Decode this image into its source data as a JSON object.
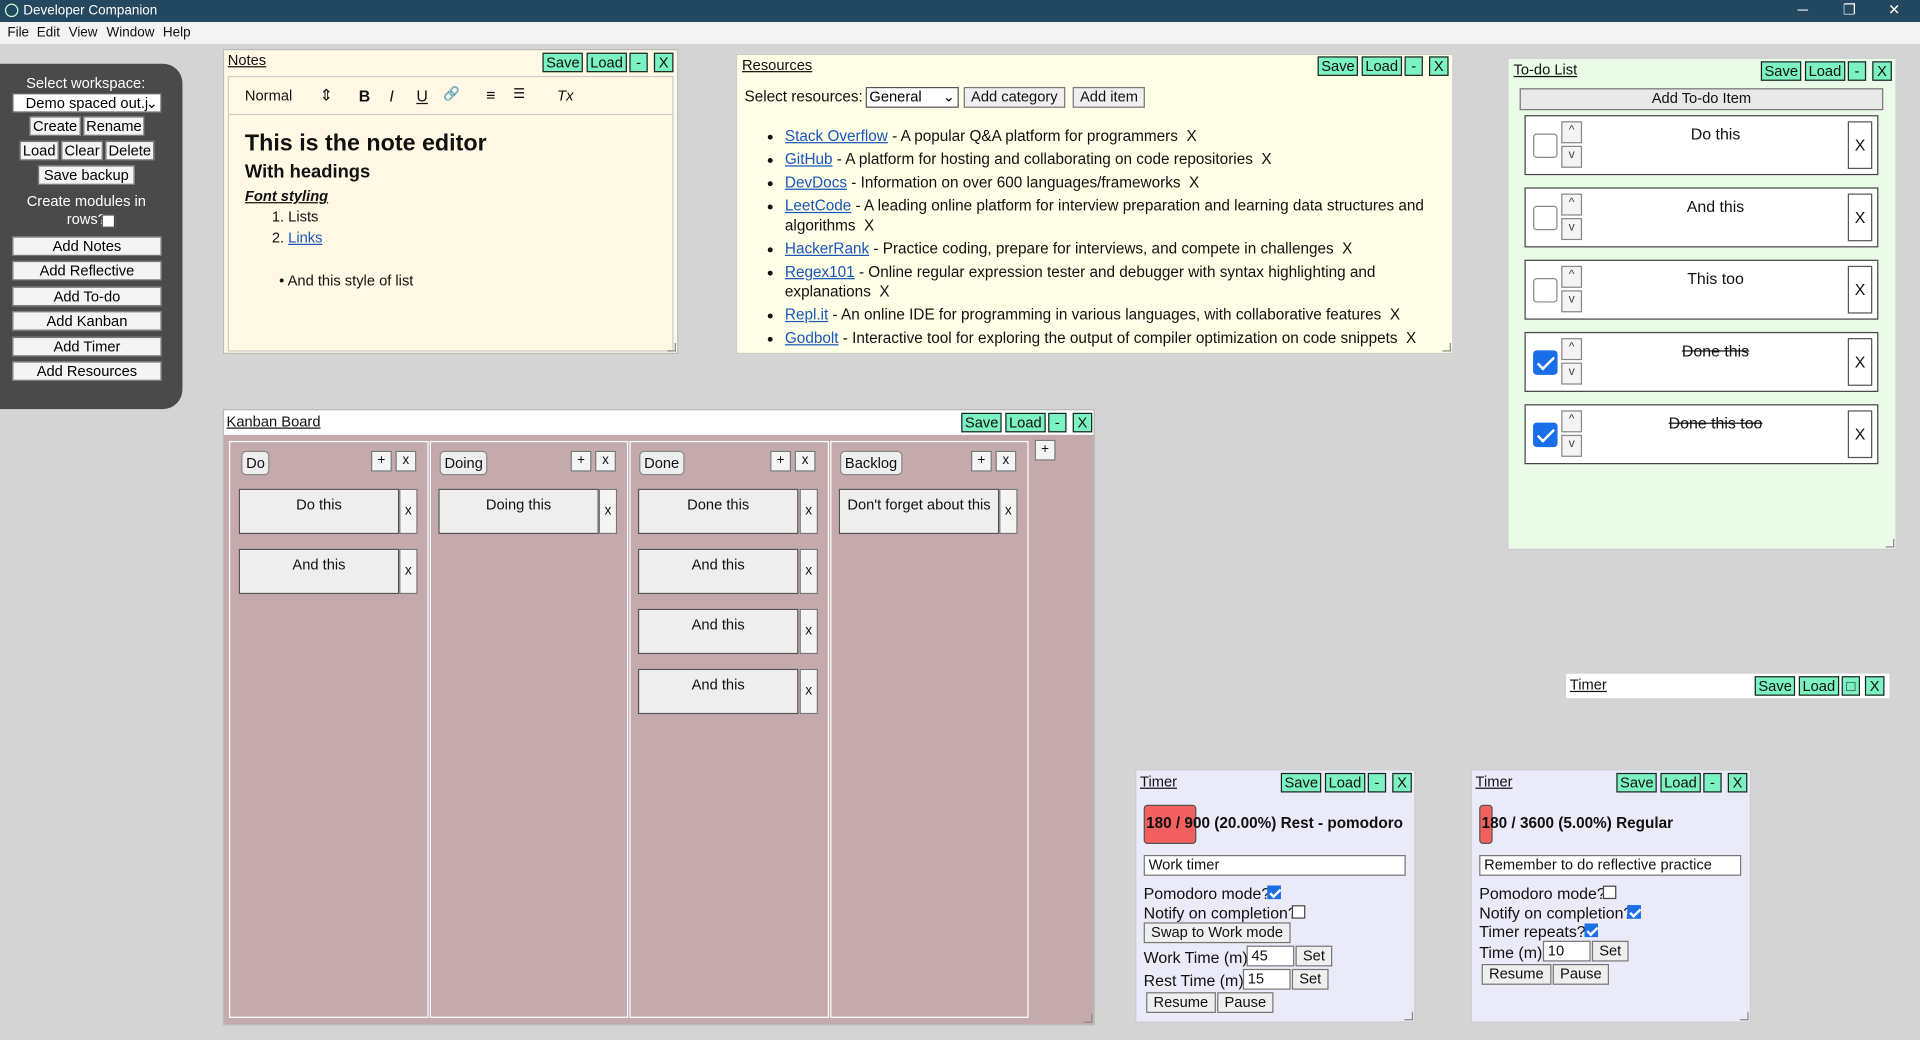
{
  "window": {
    "title": "Developer Companion",
    "controls": {
      "minimize": "─",
      "maximize": "❐",
      "close": "✕"
    }
  },
  "menu": [
    "File",
    "Edit",
    "View",
    "Window",
    "Help"
  ],
  "sidebar": {
    "select_workspace_label": "Select workspace:",
    "workspace_value": "Demo spaced out.j",
    "buttons": {
      "create": "Create",
      "rename": "Rename",
      "load": "Load",
      "clear": "Clear",
      "delete": "Delete",
      "save_backup": "Save backup"
    },
    "rows_label": "Create modules in rows?",
    "rows_checked": false,
    "add_buttons": [
      "Add Notes",
      "Add Reflective",
      "Add To-do",
      "Add Kanban",
      "Add Timer",
      "Add Resources"
    ]
  },
  "panel_buttons": {
    "save": "Save",
    "load": "Load",
    "minimize": "-",
    "close": "X",
    "restore": "□"
  },
  "notes": {
    "title": "Notes",
    "format_select": "Normal",
    "toolbar_icons": [
      "bold-icon",
      "italic-icon",
      "underline-icon",
      "link-icon",
      "ordered-list-icon",
      "bullet-list-icon",
      "clear-format-icon"
    ],
    "toolbar_glyphs": {
      "bold": "B",
      "italic": "I",
      "underline": "U",
      "link": "🔗",
      "ordered": "≡",
      "bullet": "☰",
      "clear": "Tx"
    },
    "heading1": "This is the note editor",
    "heading2": "With headings",
    "styled": "Font styling",
    "ordered_list": [
      "Lists",
      "Links"
    ],
    "bullet_item": "And this style of list"
  },
  "resources": {
    "title": "Resources",
    "select_label": "Select resources:",
    "category_value": "General",
    "add_category": "Add category",
    "add_item": "Add item",
    "items": [
      {
        "name": "Stack Overflow",
        "desc": " - A popular Q&A platform for programmers",
        "x": "X"
      },
      {
        "name": "GitHub",
        "desc": " - A platform for hosting and collaborating on code repositories",
        "x": "X"
      },
      {
        "name": "DevDocs",
        "desc": " - Information on over 600 languages/frameworks",
        "x": "X"
      },
      {
        "name": "LeetCode",
        "desc": " - A leading online platform for interview preparation and learning data structures and algorithms",
        "x": "X"
      },
      {
        "name": "HackerRank",
        "desc": " - Practice coding, prepare for interviews, and compete in challenges",
        "x": "X"
      },
      {
        "name": "Regex101",
        "desc": " - Online regular expression tester and debugger with syntax highlighting and explanations",
        "x": "X"
      },
      {
        "name": "Repl.it",
        "desc": " - An online IDE for programming in various languages, with collaborative features",
        "x": "X"
      },
      {
        "name": "Godbolt",
        "desc": " - Interactive tool for exploring the output of compiler optimization on code snippets",
        "x": "X"
      }
    ]
  },
  "todo": {
    "title": "To-do List",
    "add_label": "Add To-do Item",
    "up": "^",
    "down": "v",
    "remove": "X",
    "items": [
      {
        "text": "Do this",
        "done": false
      },
      {
        "text": "And this",
        "done": false
      },
      {
        "text": "This too",
        "done": false
      },
      {
        "text": "Done this",
        "done": true
      },
      {
        "text": "Done this too",
        "done": true
      }
    ]
  },
  "kanban": {
    "title": "Kanban Board",
    "add": "+",
    "remove": "x",
    "columns": [
      {
        "name": "Do",
        "cards": [
          "Do this",
          "And this"
        ]
      },
      {
        "name": "Doing",
        "cards": [
          "Doing this"
        ]
      },
      {
        "name": "Done",
        "cards": [
          "Done this",
          "And this",
          "And this",
          "And this"
        ]
      },
      {
        "name": "Backlog",
        "cards": [
          "Don't forget about this"
        ]
      }
    ]
  },
  "timer_minimized": {
    "title": "Timer"
  },
  "timer1": {
    "title": "Timer",
    "status": "180 / 900 (20.00%) Rest - pomodoro",
    "progress": 0.2,
    "name_value": "Work timer",
    "pomodoro_label": "Pomodoro mode?",
    "pomodoro": true,
    "notify_label": "Notify on completion?",
    "notify": false,
    "swap_label": "Swap to Work mode",
    "work_label": "Work Time (m):",
    "work_value": "45",
    "rest_label": "Rest Time (m):",
    "rest_value": "15",
    "set": "Set",
    "resume": "Resume",
    "pause": "Pause"
  },
  "timer2": {
    "title": "Timer",
    "status": "180 / 3600 (5.00%) Regular",
    "progress": 0.05,
    "name_value": "Remember to do reflective practice",
    "pomodoro_label": "Pomodoro mode?",
    "pomodoro": false,
    "notify_label": "Notify on completion?",
    "notify": true,
    "repeat_label": "Timer repeats?",
    "repeat": true,
    "time_label": "Time (m):",
    "time_value": "10",
    "set": "Set",
    "resume": "Resume",
    "pause": "Pause"
  },
  "colors": {
    "titlebar": "#24485f",
    "save_button": "#7bf2c2",
    "notes_bg": "#fff8e5",
    "resources_bg": "#ffffe8",
    "todo_bg": "#eafbe8",
    "kanban_bg": "#c4aaad",
    "timer_bg": "#eaeaf8",
    "progress": "#f26060"
  }
}
